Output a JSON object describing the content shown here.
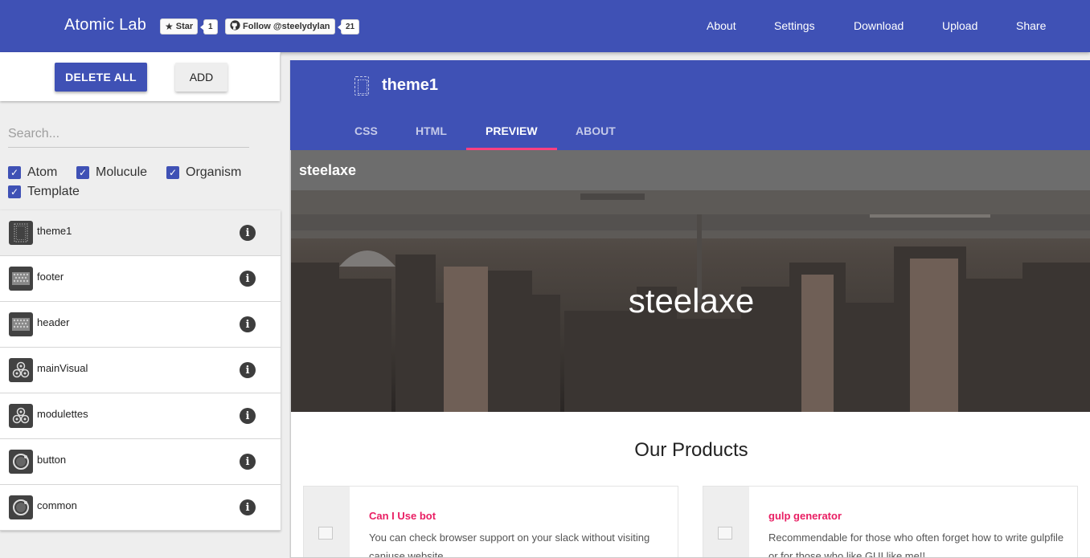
{
  "app": {
    "title": "Atomic Lab",
    "github": {
      "star_label": "Star",
      "star_count": "1",
      "follow_label": "Follow @steelydylan",
      "follow_count": "21"
    },
    "nav": [
      "About",
      "Settings",
      "Download",
      "Upload",
      "Share"
    ]
  },
  "sidebar": {
    "delete_all_label": "DELETE ALL",
    "add_label": "ADD",
    "search_placeholder": "Search...",
    "filters": [
      {
        "label": "Atom",
        "checked": true
      },
      {
        "label": "Molucule",
        "checked": true
      },
      {
        "label": "Organism",
        "checked": true
      },
      {
        "label": "Template",
        "checked": true
      }
    ],
    "items": [
      {
        "label": "theme1",
        "icon": "template-icon",
        "active": true
      },
      {
        "label": "footer",
        "icon": "organism-icon"
      },
      {
        "label": "header",
        "icon": "organism-icon"
      },
      {
        "label": "mainVisual",
        "icon": "molecule-icon"
      },
      {
        "label": "modulettes",
        "icon": "molecule-icon"
      },
      {
        "label": "button",
        "icon": "atom-icon"
      },
      {
        "label": "common",
        "icon": "atom-icon"
      }
    ],
    "info_glyph": "i"
  },
  "editor": {
    "title": "theme1",
    "tabs": [
      "CSS",
      "HTML",
      "PREVIEW",
      "ABOUT"
    ],
    "active_tab": "PREVIEW"
  },
  "preview": {
    "site_name": "steelaxe",
    "hero_title": "steelaxe",
    "products_heading": "Our Products",
    "products": [
      {
        "title": "Can I Use bot",
        "description": "You can check browser support on your slack without visiting caniuse website."
      },
      {
        "title": "gulp generator",
        "description": "Recommendable for those who often forget how to write gulpfile or for those who like GUI like me!!"
      }
    ]
  },
  "colors": {
    "primary": "#3f51b5",
    "accent": "#ff4081",
    "link": "#e91e63"
  }
}
